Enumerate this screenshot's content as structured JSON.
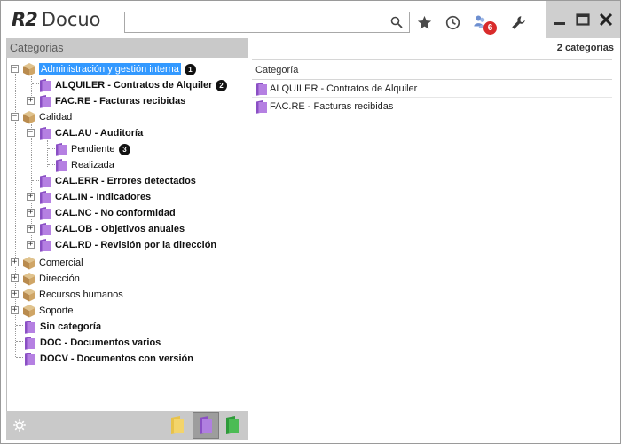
{
  "app": {
    "logo_mark": "R2",
    "logo_name": "Docuo"
  },
  "search": {
    "value": "",
    "placeholder": ""
  },
  "toolbar": {
    "icons": [
      "search-icon",
      "star-icon",
      "clock-icon",
      "users-icon",
      "wrench-icon"
    ],
    "notification_count": "6"
  },
  "left_panel": {
    "header": "Categorias",
    "tree": [
      {
        "label": "Administración y gestión interna",
        "bold": false,
        "selected": true,
        "callout": "1",
        "icon": "box-icon",
        "expander": "-"
      },
      {
        "label": "ALQUILER - Contratos de Alquiler",
        "bold": true,
        "callout": "2",
        "icon": "folder-icon",
        "expander": ""
      },
      {
        "label": "FAC.RE - Facturas recibidas",
        "bold": true,
        "icon": "folder-icon",
        "expander": "+"
      },
      {
        "label": "Calidad",
        "bold": false,
        "icon": "box-icon",
        "expander": "-"
      },
      {
        "label": "CAL.AU - Auditoría",
        "bold": true,
        "icon": "folder-icon",
        "expander": "-"
      },
      {
        "label": "Pendiente",
        "bold": false,
        "callout": "3",
        "icon": "folder-icon",
        "expander": ""
      },
      {
        "label": "Realizada",
        "bold": false,
        "icon": "folder-icon",
        "expander": ""
      },
      {
        "label": "CAL.ERR - Errores detectados",
        "bold": true,
        "icon": "folder-icon",
        "expander": ""
      },
      {
        "label": "CAL.IN - Indicadores",
        "bold": true,
        "icon": "folder-icon",
        "expander": "+"
      },
      {
        "label": "CAL.NC - No conformidad",
        "bold": true,
        "icon": "folder-icon",
        "expander": "+"
      },
      {
        "label": "CAL.OB - Objetivos anuales",
        "bold": true,
        "icon": "folder-icon",
        "expander": "+"
      },
      {
        "label": "CAL.RD - Revisión por la dirección",
        "bold": true,
        "icon": "folder-icon",
        "expander": "+"
      },
      {
        "label": "Comercial",
        "bold": false,
        "icon": "box-icon",
        "expander": "+"
      },
      {
        "label": "Dirección",
        "bold": false,
        "icon": "box-icon",
        "expander": "+"
      },
      {
        "label": "Recursos humanos",
        "bold": false,
        "icon": "box-icon",
        "expander": "+"
      },
      {
        "label": "Soporte",
        "bold": false,
        "icon": "box-icon",
        "expander": "+"
      },
      {
        "label": "Sin categoría",
        "bold": true,
        "icon": "folder-icon",
        "expander": ""
      },
      {
        "label": "DOC - Documentos varios",
        "bold": true,
        "icon": "folder-icon",
        "expander": ""
      },
      {
        "label": "DOCV - Documentos con versión",
        "bold": true,
        "icon": "folder-icon",
        "expander": ""
      }
    ],
    "footer_icons": [
      "gear-icon",
      "yellow-folder-icon",
      "purple-folder-icon",
      "green-folder-icon"
    ]
  },
  "right_panel": {
    "count_label": "2 categorias",
    "column_header": "Categoría",
    "rows": [
      {
        "label": "ALQUILER - Contratos de Alquiler",
        "icon": "folder-icon"
      },
      {
        "label": "FAC.RE - Facturas recibidas",
        "icon": "folder-icon"
      }
    ]
  },
  "colors": {
    "selection": "#3399ff",
    "category_folder": "#a86ad4",
    "root_box": "#c8a46a",
    "panel_header": "#c9c9c9",
    "badge": "#d92b2b"
  }
}
